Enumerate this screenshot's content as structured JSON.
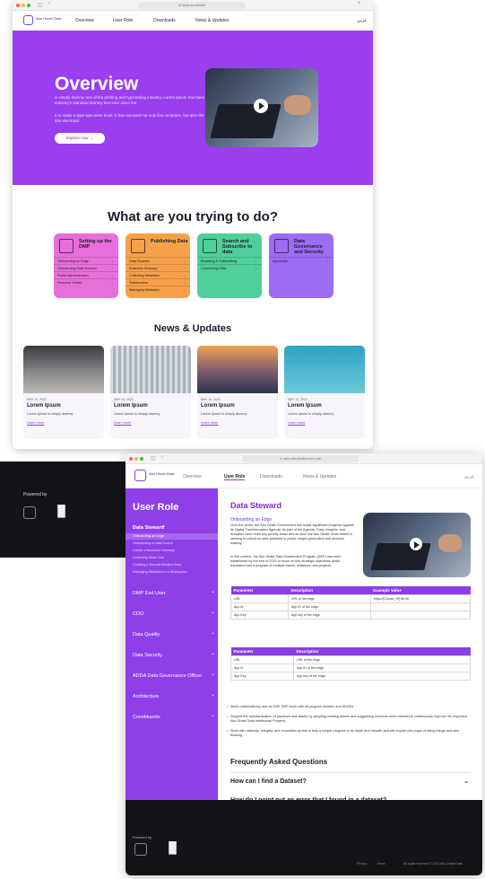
{
  "window1": {
    "url": "& data.abudhabi",
    "nav": {
      "logo_text": "Abu Dhabi Data",
      "links": [
        "Overview",
        "User Role",
        "Downloads",
        "News & Updates"
      ],
      "lang": "عربي"
    },
    "hero": {
      "title": "Overview",
      "text1": "is simply dummy text of the printing and typesetting industry. Lorem Ipsum has been the industry's standard dummy text ever since the",
      "text2": "it to make a type specimen book. It has survived not only five centuries, but also the leap into electronic",
      "button": "Explore now →"
    },
    "what_title": "What are you trying to do?",
    "cards": [
      {
        "title": "Setting up the DMP",
        "color": "#e86fd9",
        "items": [
          "Onboarding an Edge",
          "Onboarding Data Sources",
          "Portal Administration",
          "Personal Center"
        ]
      },
      {
        "title": "Publishing Data",
        "color": "#f6a14a",
        "items": [
          "Data Sources",
          "Business Glossary",
          "Collecting Metadata",
          "Subdomains",
          "Managing Metadata"
        ]
      },
      {
        "title": "Search and Subscribe to data",
        "color": "#4fcf9a",
        "items": [
          "Browsing & Subscribing",
          "Consuming Data"
        ]
      },
      {
        "title": "Data Governance and Security",
        "color": "#9b6cf4",
        "items": [
          "Approvals"
        ]
      }
    ],
    "news_title": "News & Updates",
    "news": [
      {
        "date": "MAY 14, 2022",
        "title": "Lorem Ipsum",
        "desc": "Lorem Ipsum is simply dummy",
        "more": "Learn more"
      },
      {
        "date": "MAY 14, 2022",
        "title": "Lorem Ipsum",
        "desc": "Lorem Ipsum is simply dummy",
        "more": "Learn more"
      },
      {
        "date": "MAY 14, 2022",
        "title": "Lorem Ipsum",
        "desc": "Lorem Ipsum is simply dummy",
        "more": "Learn more"
      },
      {
        "date": "MAY 14, 2022",
        "title": "Lorem Ipsum",
        "desc": "Lorem Ipsum is simply dummy",
        "more": "Learn more"
      }
    ]
  },
  "darkfoot": {
    "powered": "Powered by"
  },
  "window2": {
    "url": "& data.abudhabi/user-role",
    "nav": {
      "logo_text": "Abu Dhabi Data",
      "links": [
        "Overview",
        "User Role",
        "Downloads",
        "News & Updates"
      ],
      "lang": "عربي"
    },
    "sidebar": {
      "title": "User Role",
      "active_section": "Data Steward",
      "sub_items": [
        "Onboarding an Edge",
        "Onboarding a Data Source",
        "Create a Business Glossary",
        "Collecting Meta Data",
        "Creating a Domain/Subject Area",
        "Managing Metadata in a Workspace"
      ],
      "sections": [
        "DMP End User",
        "CDO",
        "Data Quality",
        "Data Security",
        "ADDA Data Governance Officer",
        "Architecture",
        "Constituents"
      ]
    },
    "content": {
      "title": "Data Steward",
      "subtitle": "Onboarding an Edge",
      "para1": "Over the years, the Abu Dhabi Government has made significant progress against its Digital Transformation Agenda. As part of the Agenda, Data, Insights, and Analytics have been key priority areas and as such the Abu Dhabi Government is seeking to unlock its data potential to power insight generation and decision making.",
      "para2": "In this context, the Abu Dhabi Data Enablement Program (DEP) has been established by the end of 2020 to focus on key strategic objectives which translated into a program of multiple tracks, initiatives, and projects.",
      "table1": {
        "headers": [
          "Parameter",
          "Description",
          "Example Value"
        ],
        "rows": [
          [
            "URL",
            "URL of the edge",
            "https://[Cluster_IP]:5b.40"
          ],
          [
            "App Id",
            "App ID of the edge",
            "-"
          ],
          [
            "App Key",
            "App key of the edge",
            "-"
          ]
        ]
      },
      "table2": {
        "headers": [
          "Parameter",
          "Description"
        ],
        "rows": [
          [
            "URL",
            "URL of the edge"
          ],
          [
            "App Id",
            "App ID of the edge"
          ],
          [
            "App Key",
            "App key of the edge"
          ]
        ]
      },
      "bullets": [
        "Work collaboratively and as ONE DEP team with all program vendors and ADGEs",
        "Support the standardization of practices and assets by adopting existing assets and suggesting revisions when needed to continuously improve the important Abu Dhabi Data Intellectual Property",
        "Work with Intensity, Integrity, and Innovation as this is truly a unique program in its depth and breadth and will require new ways of doing things and new thinking"
      ],
      "faq_title": "Frequently Asked Questions",
      "faqs": [
        "How can I find a Dataset?",
        "How do I point out an error that I found in a dataset?"
      ]
    },
    "footer": {
      "powered": "Powered by",
      "privacy": "Privacy",
      "terms": "Terms",
      "copyright": "All rights reserved © 2022 Abu Dhabi Data"
    }
  }
}
